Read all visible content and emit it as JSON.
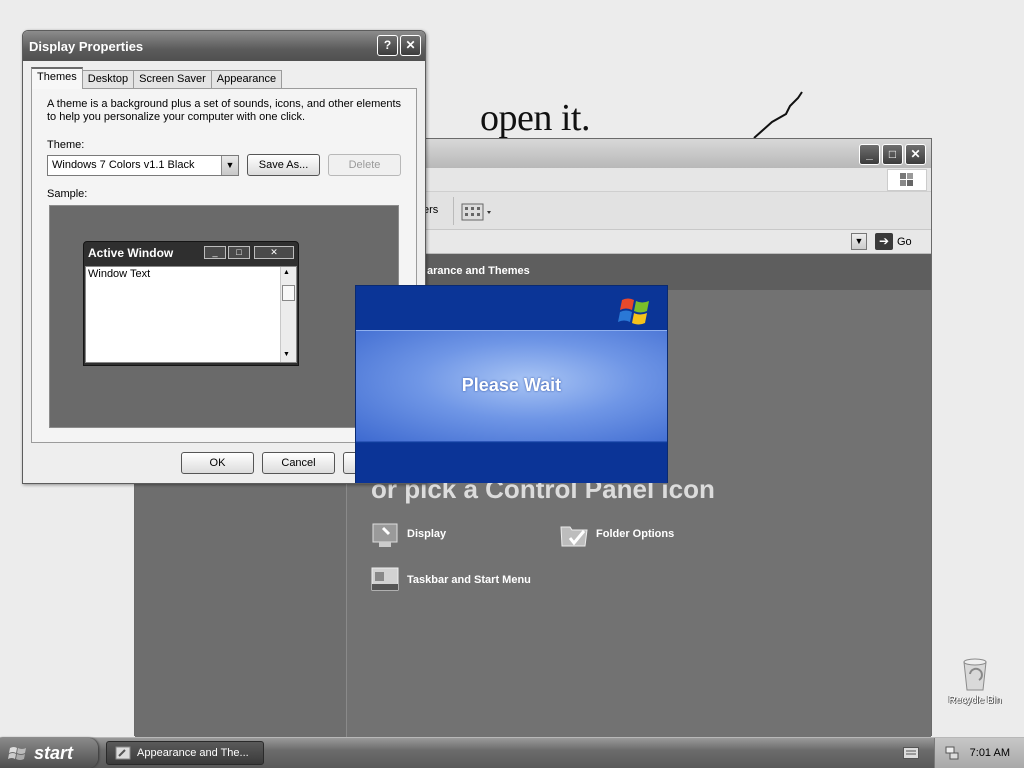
{
  "desktop": {
    "handwriting": "open it.",
    "recycle_bin_label": "Recycle Bin"
  },
  "control_panel": {
    "toolbar_fragment": "ers",
    "address_go": "Go",
    "content_header": "arance and Themes",
    "pick_text": "or pick a Control Panel icon",
    "items": [
      {
        "label": "Display",
        "icon": "display-icon"
      },
      {
        "label": "Folder Options",
        "icon": "folder-options-icon"
      },
      {
        "label": "Taskbar and Start Menu",
        "icon": "taskbar-start-icon"
      }
    ]
  },
  "dialog": {
    "title": "Display Properties",
    "tabs": [
      "Themes",
      "Desktop",
      "Screen Saver",
      "Appearance"
    ],
    "active_tab": "Themes",
    "description": "A theme is a background plus a set of sounds, icons, and other elements to help you personalize your computer with one click.",
    "theme_label": "Theme:",
    "theme_value": "Windows 7 Colors v1.1 Black",
    "save_as": "Save As...",
    "delete": "Delete",
    "sample_label": "Sample:",
    "preview": {
      "title": "Active Window",
      "body_text": "Window Text"
    },
    "ok": "OK",
    "cancel": "Cancel"
  },
  "splash": {
    "text": "Please Wait"
  },
  "taskbar": {
    "start": "start",
    "task_label": "Appearance and The...",
    "clock": "7:01 AM"
  },
  "colors": {
    "splash_blue": "#0e3c9c",
    "taskbar_gray": "#5a5a5a"
  }
}
